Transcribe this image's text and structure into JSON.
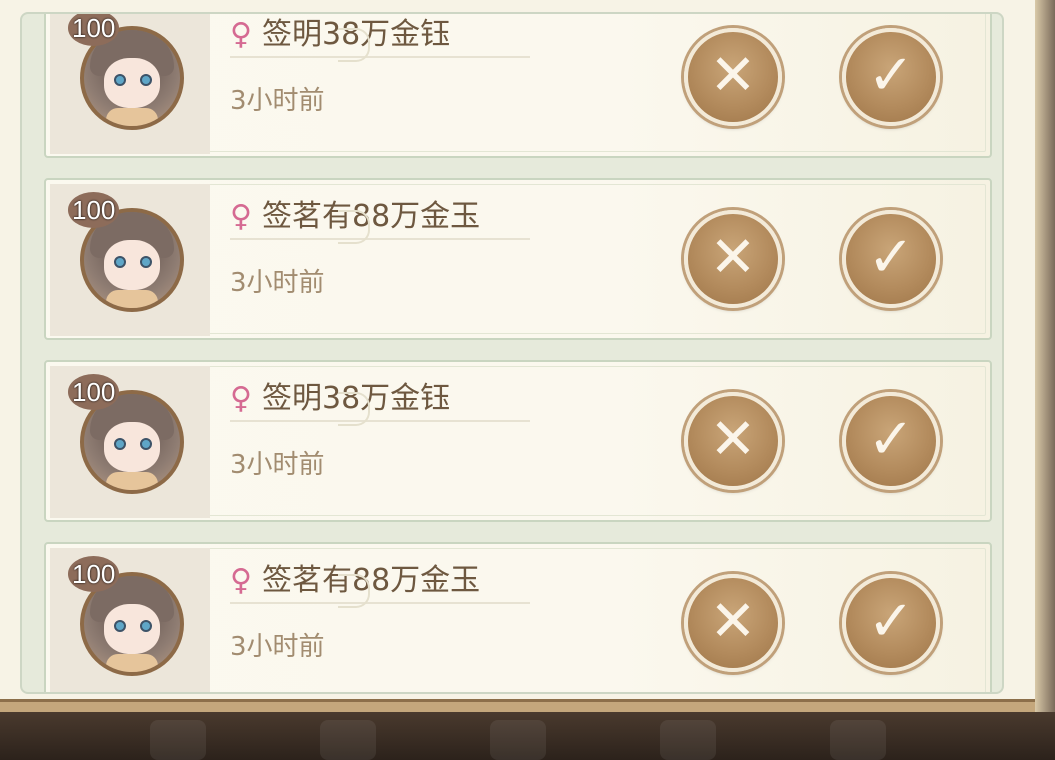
{
  "requests": [
    {
      "level": "100",
      "gender_icon": "♀",
      "name": "签明38万金钰",
      "time": "3小时前",
      "reject_icon": "✕",
      "accept_icon": "✓"
    },
    {
      "level": "100",
      "gender_icon": "♀",
      "name": "签茗有88万金玉",
      "time": "3小时前",
      "reject_icon": "✕",
      "accept_icon": "✓"
    },
    {
      "level": "100",
      "gender_icon": "♀",
      "name": "签明38万金钰",
      "time": "3小时前",
      "reject_icon": "✕",
      "accept_icon": "✓"
    },
    {
      "level": "100",
      "gender_icon": "♀",
      "name": "签茗有88万金玉",
      "time": "3小时前",
      "reject_icon": "✕",
      "accept_icon": "✓"
    }
  ],
  "colors": {
    "gender_female": "#d56a92",
    "button_gold": "#b38b5d",
    "name_text": "#6e5840",
    "time_text": "#a28c70"
  }
}
